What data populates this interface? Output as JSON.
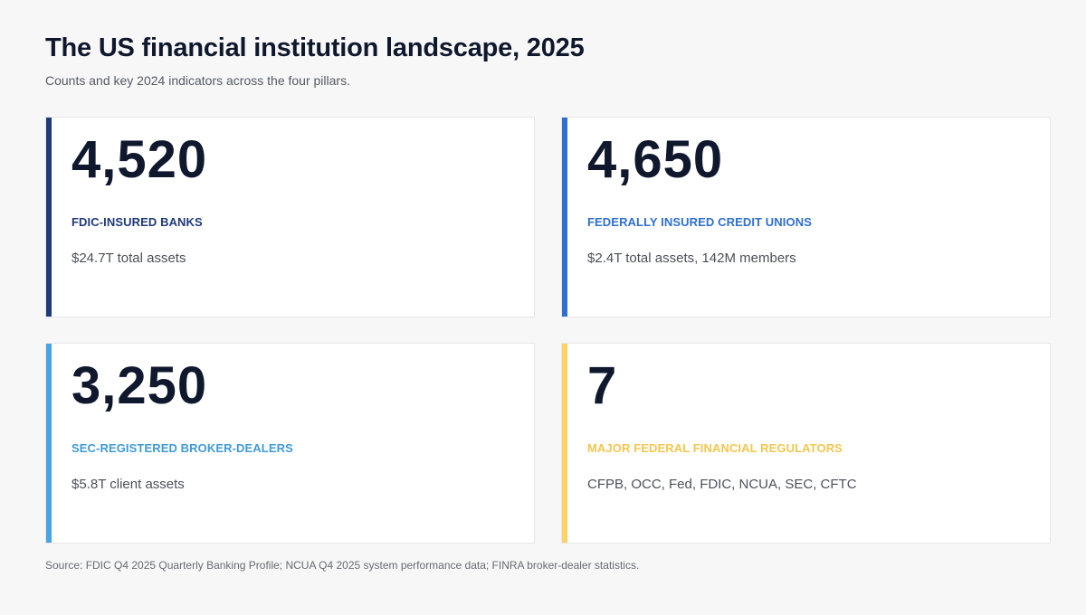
{
  "header": {
    "title": "The US financial institution landscape, 2025",
    "subtitle": "Counts and key 2024 indicators across the four pillars."
  },
  "cards": [
    {
      "value": "4,520",
      "label": "FDIC-INSURED BANKS",
      "detail": "$24.7T total assets",
      "accent_color": "#1f3a7a",
      "label_color": "#1f3a7a"
    },
    {
      "value": "4,650",
      "label": "FEDERALLY INSURED CREDIT UNIONS",
      "detail": "$2.4T total assets, 142M members",
      "accent_color": "#2f6fd0",
      "label_color": "#2f6fd0"
    },
    {
      "value": "3,250",
      "label": "SEC-REGISTERED BROKER-DEALERS",
      "detail": "$5.8T client assets",
      "accent_color": "#4aa3e3",
      "label_color": "#3f9ad8"
    },
    {
      "value": "7",
      "label": "MAJOR FEDERAL FINANCIAL REGULATORS",
      "detail": "CFPB, OCC, Fed, FDIC, NCUA, SEC, CFTC",
      "accent_color": "#ffd166",
      "label_color": "#f5c64f"
    }
  ],
  "footer": {
    "source": "Source: FDIC Q4 2025 Quarterly Banking Profile; NCUA Q4 2025 system performance data; FINRA broker-dealer statistics."
  }
}
